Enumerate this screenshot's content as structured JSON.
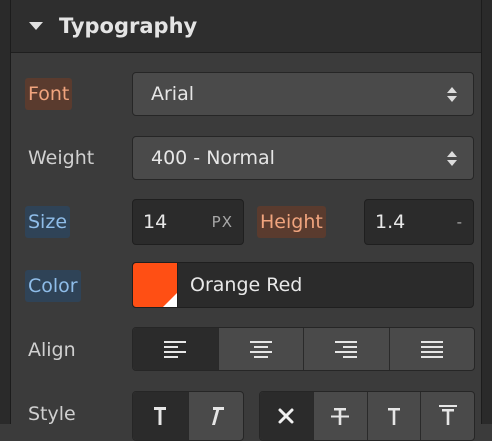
{
  "section": {
    "title": "Typography"
  },
  "font": {
    "label": "Font",
    "value": "Arial"
  },
  "weight": {
    "label": "Weight",
    "value": "400 - Normal"
  },
  "size": {
    "label": "Size",
    "value": "14",
    "unit": "PX"
  },
  "height": {
    "label": "Height",
    "value": "1.4",
    "unit": "-"
  },
  "color": {
    "label": "Color",
    "name": "Orange Red",
    "hex": "#ff4500"
  },
  "align": {
    "label": "Align",
    "options": [
      "left",
      "center",
      "right",
      "justify"
    ],
    "selected": "left"
  },
  "style": {
    "label": "Style",
    "italic_options": [
      "regular",
      "italic"
    ],
    "selected_italic": "regular",
    "decoration_options": [
      "none",
      "strikethrough",
      "underline",
      "overline"
    ],
    "selected_decoration": "none"
  },
  "colors": {
    "accent_orange": "#f0a47e",
    "accent_blue": "#8fbde9"
  }
}
